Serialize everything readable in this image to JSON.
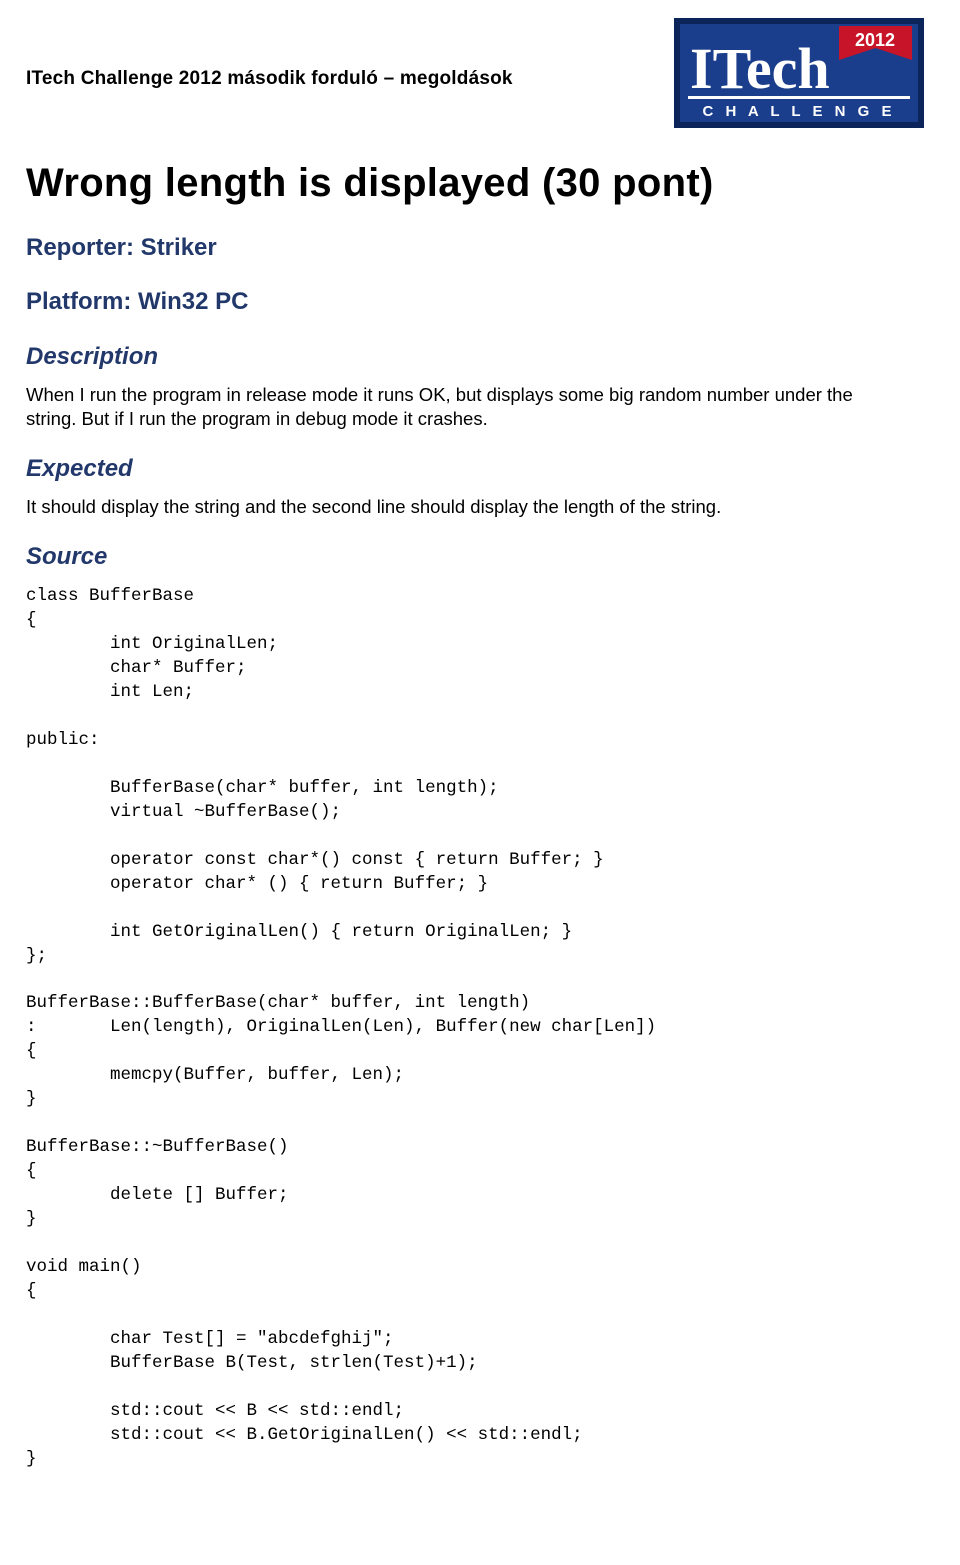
{
  "header": {
    "title": "ITech Challenge 2012 második forduló – megoldások"
  },
  "logo": {
    "year": "2012",
    "brand1": "ITech",
    "brand2": "C H A L L E N G E"
  },
  "main": {
    "title": "Wrong length is displayed (30 pont)",
    "reporter_h": "Reporter: Striker",
    "platform_h": "Platform: Win32 PC",
    "desc_h": "Description",
    "desc_body": "When I run the program in release mode it runs OK, but displays some big random number under the string. But if I run the program in debug mode it crashes.",
    "expected_h": "Expected",
    "expected_body": "It should display the string and the second line should display the length of the string.",
    "source_h": "Source",
    "source_code": "class BufferBase\n{\n        int OriginalLen;\n        char* Buffer;\n        int Len;\n\npublic:\n\n        BufferBase(char* buffer, int length);\n        virtual ~BufferBase();\n\n        operator const char*() const { return Buffer; }\n        operator char* () { return Buffer; }\n\n        int GetOriginalLen() { return OriginalLen; }\n};\n\nBufferBase::BufferBase(char* buffer, int length)\n:       Len(length), OriginalLen(Len), Buffer(new char[Len])\n{\n        memcpy(Buffer, buffer, Len);\n}\n\nBufferBase::~BufferBase()\n{\n        delete [] Buffer;\n}\n\nvoid main()\n{\n\n        char Test[] = \"abcdefghij\";\n        BufferBase B(Test, strlen(Test)+1);\n\n        std::cout << B << std::endl;\n        std::cout << B.GetOriginalLen() << std::endl;\n}"
  }
}
